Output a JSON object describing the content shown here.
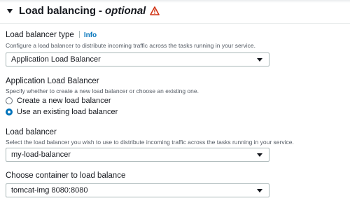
{
  "section": {
    "title": "Load balancing",
    "separator": "-",
    "optional": "optional",
    "warning_icon": "warning-triangle-icon",
    "colors": {
      "warning": "#d13212",
      "link": "#0073bb",
      "radio_selected": "#0073bb"
    }
  },
  "lb_type": {
    "label": "Load balancer type",
    "info": "Info",
    "description": "Configure a load balancer to distribute incoming traffic across the tasks running in your service.",
    "value": "Application Load Balancer"
  },
  "alb": {
    "label": "Application Load Balancer",
    "description": "Specify whether to create a new load balancer or choose an existing one.",
    "options": [
      {
        "label": "Create a new load balancer",
        "selected": false
      },
      {
        "label": "Use an existing load balancer",
        "selected": true
      }
    ]
  },
  "load_balancer": {
    "label": "Load balancer",
    "description": "Select the load balancer you wish to use to distribute incoming traffic across the tasks running in your service.",
    "value": "my-load-balancer"
  },
  "container": {
    "label": "Choose container to load balance",
    "value": "tomcat-img 8080:8080"
  }
}
